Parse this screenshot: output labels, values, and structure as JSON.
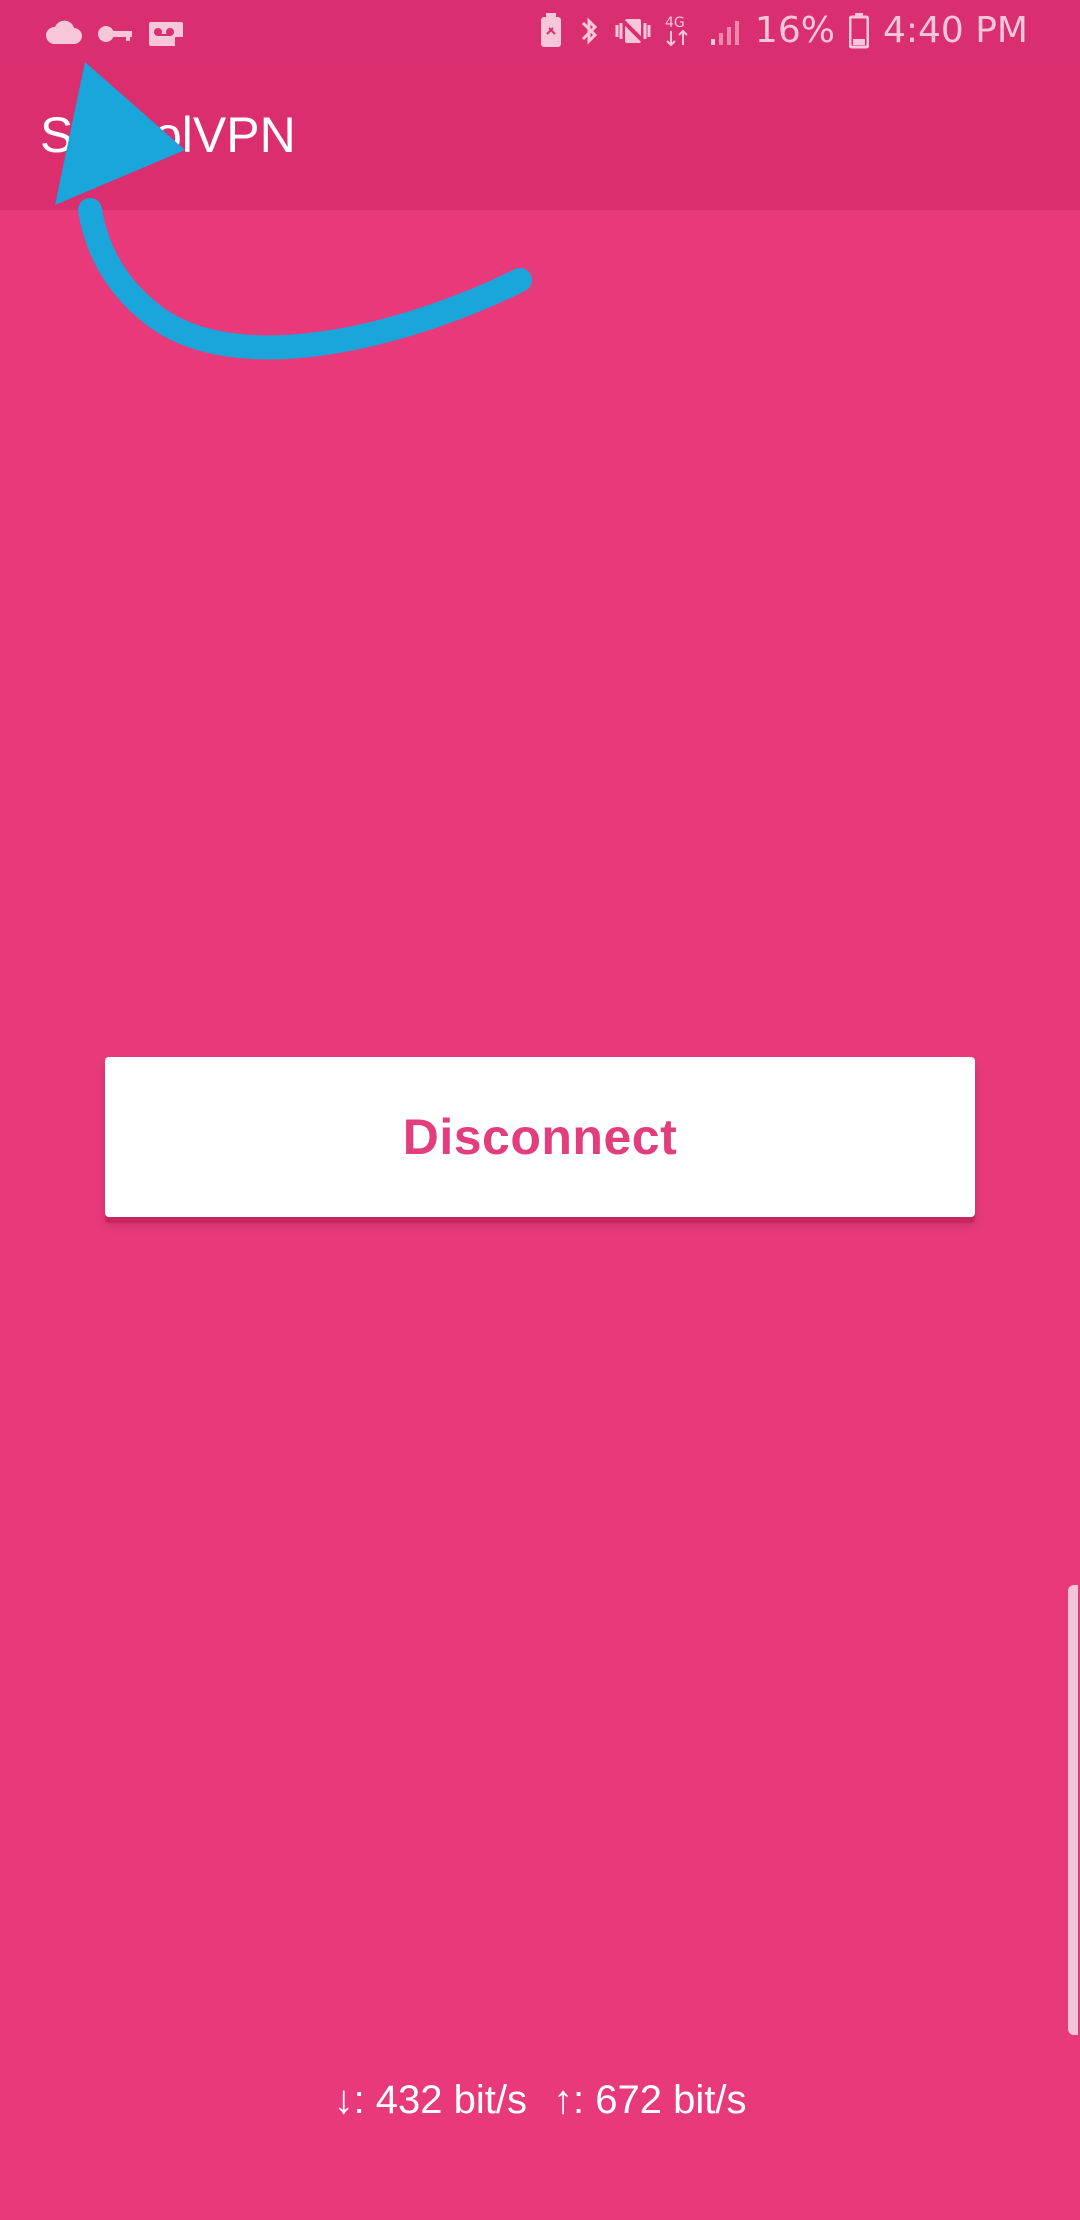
{
  "status_bar": {
    "battery_percent": "16%",
    "time": "4:40 PM",
    "left_icons": [
      "cloud-icon",
      "key-icon",
      "voicemail-icon"
    ],
    "right_icons": [
      "battery-saver-icon",
      "bluetooth-icon",
      "vibrate-off-icon",
      "network-4g-icon",
      "signal-icon",
      "battery-icon"
    ]
  },
  "app": {
    "title": "SchoolVPN"
  },
  "main": {
    "disconnect_label": "Disconnect"
  },
  "traffic": {
    "down_arrow": "↓",
    "down_text": ": 432 bit/s",
    "up_arrow": "↑",
    "up_text": ": 672 bit/s"
  },
  "colors": {
    "background": "#e83a7b",
    "app_bar": "#da2e6e",
    "button_text": "#e23e7d",
    "annotation_arrow": "#1aa5db"
  },
  "annotation": {
    "icon": "annotation-arrow-icon"
  }
}
